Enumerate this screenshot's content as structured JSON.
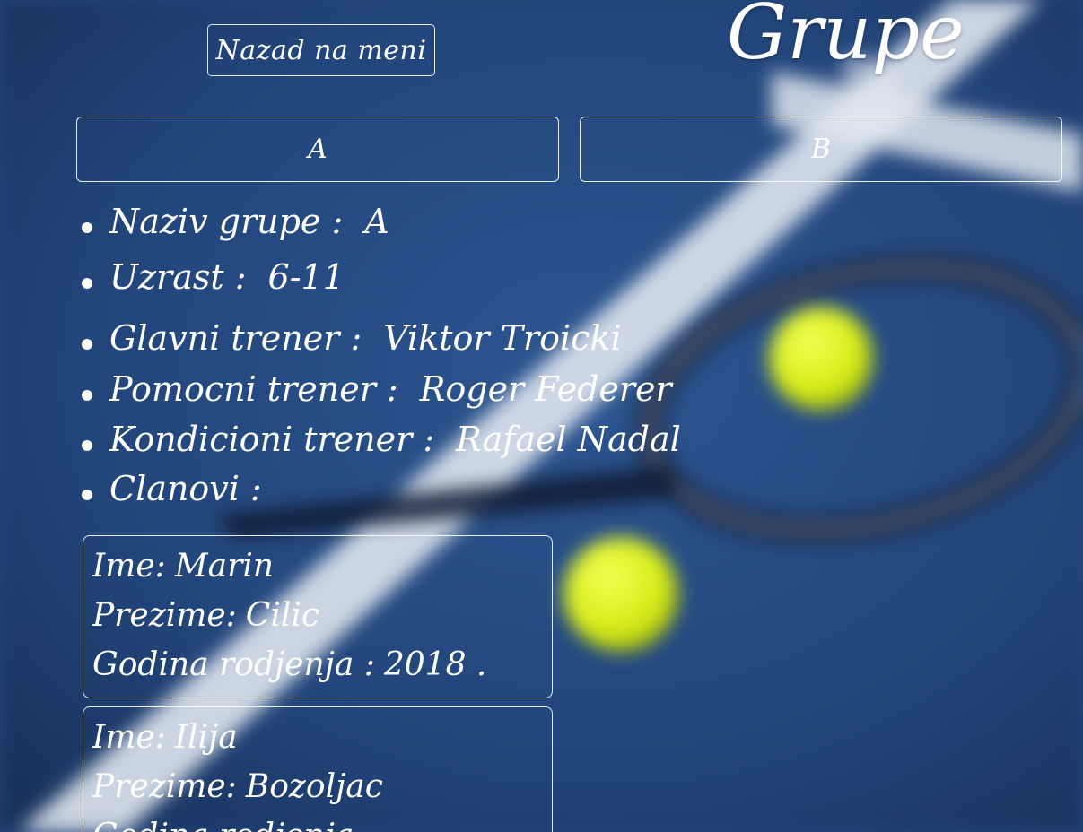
{
  "nav": {
    "back_label": "Nazad na meni"
  },
  "page": {
    "title": "Grupe"
  },
  "groups": [
    {
      "label": "A"
    },
    {
      "label": "B"
    }
  ],
  "group_info": {
    "name_label": "Naziv grupe :",
    "name_value": "A",
    "age_label": "Uzrast :",
    "age_value": "6-11",
    "head_coach_label": "Glavni trener :",
    "head_coach_value": "Viktor Troicki",
    "assistant_coach_label": "Pomocni trener :",
    "assistant_coach_value": "Roger Federer",
    "fitness_coach_label": "Kondicioni trener :",
    "fitness_coach_value": "Rafael Nadal",
    "members_label": "Clanovi :"
  },
  "members": [
    {
      "first_name_label": "Ime:",
      "first_name": "Marin",
      "last_name_label": "Prezime:",
      "last_name": "Cilic",
      "birth_year_label": "Godina rodjenja :",
      "birth_year": "2018 ."
    },
    {
      "first_name_label": "Ime:",
      "first_name": "Ilija",
      "last_name_label": "Prezime:",
      "last_name": "Bozoljac",
      "birth_year_label": "Godina rodjenja :",
      "birth_year": ""
    }
  ],
  "colors": {
    "court_blue": "#23457a",
    "court_lines": "#dfe6ee",
    "ball_yellow": "#d9ef1c",
    "text": "#ffffff"
  }
}
